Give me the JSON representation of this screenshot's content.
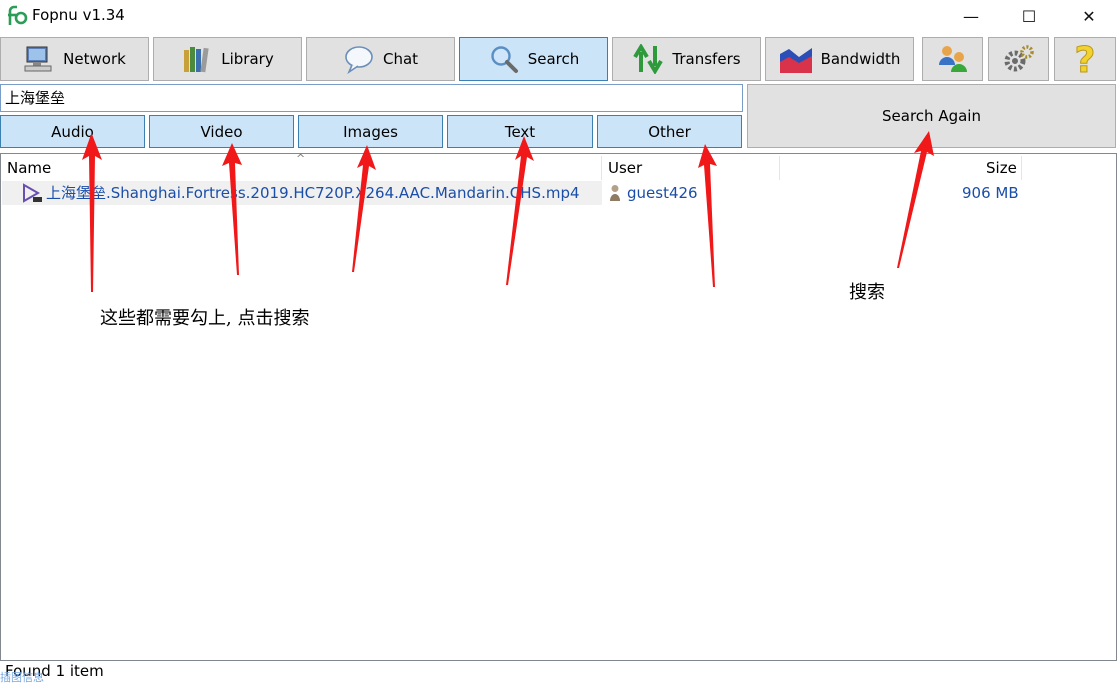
{
  "window": {
    "title": "Fopnu v1.34",
    "minimize_glyph": "—",
    "maximize_glyph": "☐",
    "close_glyph": "✕"
  },
  "toolbar": {
    "network": "Network",
    "library": "Library",
    "chat": "Chat",
    "search": "Search",
    "transfers": "Transfers",
    "bandwidth": "Bandwidth"
  },
  "search": {
    "query": "上海堡垒",
    "again_label": "Search Again",
    "filters": [
      "Audio",
      "Video",
      "Images",
      "Text",
      "Other"
    ]
  },
  "results": {
    "columns": {
      "name": "Name",
      "user": "User",
      "size": "Size"
    },
    "rows": [
      {
        "name": "上海堡垒.Shanghai.Fortress.2019.HC720P.X264.AAC.Mandarin.CHS.mp4",
        "user": "guest426",
        "size": "906 MB"
      }
    ]
  },
  "status": {
    "text": "Found 1 item",
    "corner": "插图信息"
  },
  "annotations": {
    "note_filters": "这些都需要勾上, 点击搜索",
    "note_search": "搜索"
  },
  "colors": {
    "active_button": "#cce4f7",
    "active_border": "#3c7fb1",
    "button_bg": "#e1e1e1",
    "link_text": "#1a4ea8",
    "annotation_arrow": "#f01818"
  }
}
